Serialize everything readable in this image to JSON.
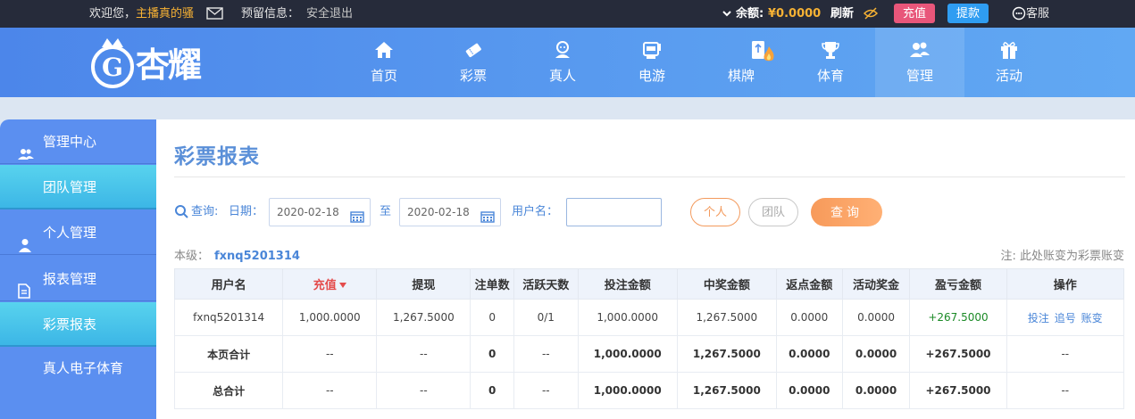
{
  "topbar": {
    "welcome": "欢迎您，",
    "username": "主播真的骚",
    "reserved_label": "预留信息：",
    "logout": "安全退出",
    "balance_label": "余额:",
    "balance_value": "¥0.0000",
    "refresh": "刷新",
    "recharge": "充值",
    "withdraw": "提款",
    "service": "客服"
  },
  "brand": {
    "name": "杏耀"
  },
  "nav": [
    {
      "label": "首页",
      "icon": "home-icon"
    },
    {
      "label": "彩票",
      "icon": "lottery-icon"
    },
    {
      "label": "真人",
      "icon": "live-dealer-icon"
    },
    {
      "label": "电游",
      "icon": "slot-icon"
    },
    {
      "label": "棋牌",
      "icon": "cards-icon"
    },
    {
      "label": "体育",
      "icon": "trophy-icon"
    },
    {
      "label": "管理",
      "icon": "users-icon"
    },
    {
      "label": "活动",
      "icon": "gift-icon"
    }
  ],
  "sidebar": {
    "manage_center": "管理中心",
    "team_manage": "团队管理",
    "personal_manage": "个人管理",
    "report_manage": "报表管理",
    "lottery_report": "彩票报表",
    "live_sports": "真人电子体育"
  },
  "page": {
    "title": "彩票报表",
    "query_label": "查询:",
    "date_label": "日期：",
    "date_from": "2020-02-18",
    "to_label": "至",
    "date_to": "2020-02-18",
    "user_label": "用户名：",
    "user_value": "",
    "personal_btn": "个人",
    "team_btn": "团队",
    "query_btn": "查询",
    "level_label": "本级：",
    "level_user": "fxnq5201314",
    "note": "注: 此处账变为彩票账变"
  },
  "table": {
    "headers": [
      "用户名",
      "充值",
      "提现",
      "注单数",
      "活跃天数",
      "投注金额",
      "中奖金额",
      "返点金额",
      "活动奖金",
      "盈亏金额",
      "操作"
    ],
    "row": [
      "fxnq5201314",
      "1,000.0000",
      "1,267.5000",
      "0",
      "0/1",
      "1,000.0000",
      "1,267.5000",
      "0.0000",
      "0.0000",
      "+267.5000"
    ],
    "ops": [
      "投注",
      "追号",
      "账变"
    ],
    "page_total": [
      "本页合计",
      "--",
      "--",
      "0",
      "--",
      "1,000.0000",
      "1,267.5000",
      "0.0000",
      "0.0000",
      "+267.5000",
      "--"
    ],
    "grand_total": [
      "总合计",
      "--",
      "--",
      "0",
      "--",
      "1,000.0000",
      "1,267.5000",
      "0.0000",
      "0.0000",
      "+267.5000",
      "--"
    ]
  },
  "colors": {
    "accent": "#4a86d8",
    "recharge": "#e8567a",
    "withdraw": "#2f9df2",
    "query": "#f79a5a",
    "profit": "#1b8a26"
  }
}
